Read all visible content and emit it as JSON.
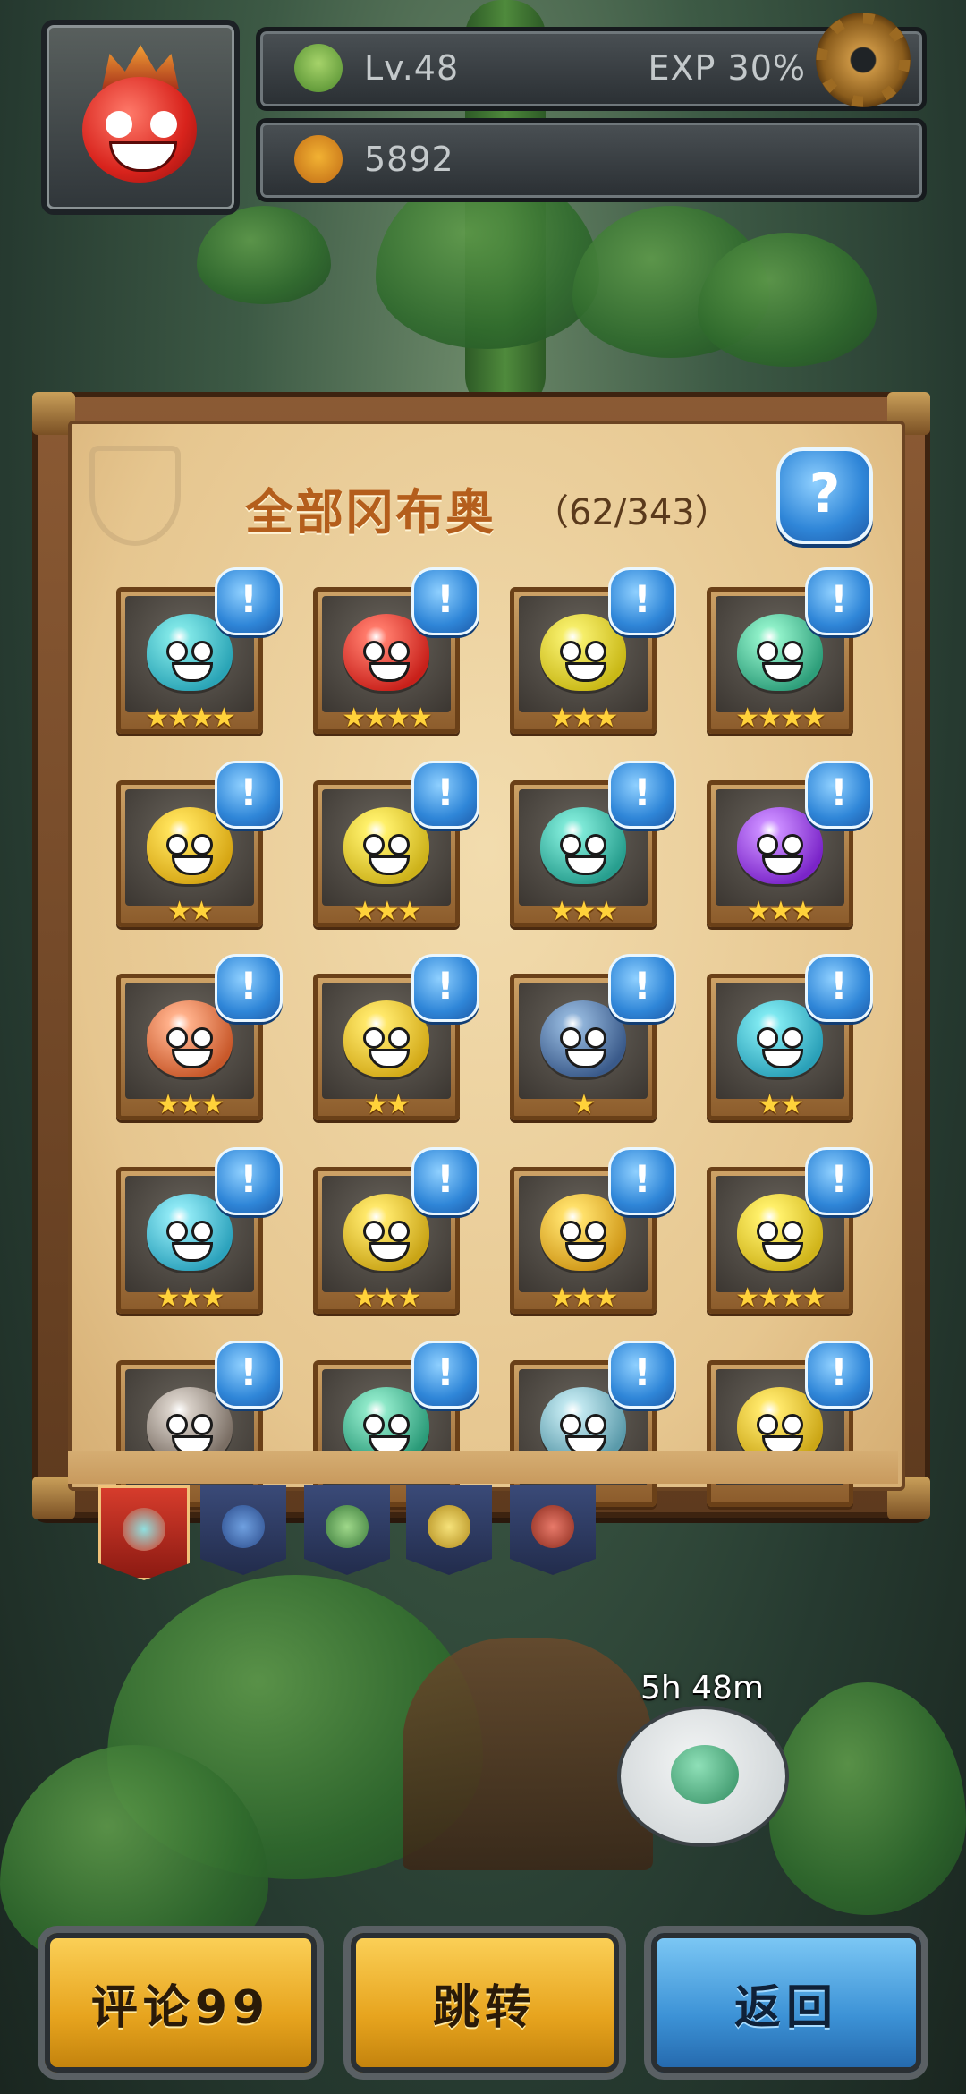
{
  "hud": {
    "level": "Lv.48",
    "exp": "EXP 30%",
    "currency": "5892"
  },
  "panel": {
    "title": "全部冈布奥",
    "count": "（62/343）",
    "help_label": "?"
  },
  "collection": [
    {
      "stars": "★★★★",
      "color1": "#7fe6e6",
      "color2": "#2aa4b6"
    },
    {
      "stars": "★★★★",
      "color1": "#ff7a6a",
      "color2": "#c8201a"
    },
    {
      "stars": "★★★",
      "color1": "#f6ee6a",
      "color2": "#c9b816"
    },
    {
      "stars": "★★★★",
      "color1": "#8ff0c8",
      "color2": "#2e9e7a"
    },
    {
      "stars": "★★",
      "color1": "#ffe25a",
      "color2": "#d6a614"
    },
    {
      "stars": "★★★",
      "color1": "#fff06a",
      "color2": "#cdb21a"
    },
    {
      "stars": "★★★",
      "color1": "#7de8d6",
      "color2": "#279e8e"
    },
    {
      "stars": "★★★",
      "color1": "#c98aff",
      "color2": "#7a24c8"
    },
    {
      "stars": "★★★",
      "color1": "#ffb08a",
      "color2": "#c8582a"
    },
    {
      "stars": "★★",
      "color1": "#ffe86a",
      "color2": "#d3aa18"
    },
    {
      "stars": "★",
      "color1": "#8fb2d8",
      "color2": "#3a5a8a"
    },
    {
      "stars": "★★",
      "color1": "#7ee8f0",
      "color2": "#2aa0b8"
    },
    {
      "stars": "★★★",
      "color1": "#8ee8f4",
      "color2": "#2ca2bc"
    },
    {
      "stars": "★★★",
      "color1": "#ffe86a",
      "color2": "#c9a416"
    },
    {
      "stars": "★★★",
      "color1": "#ffe06a",
      "color2": "#d09818"
    },
    {
      "stars": "★★★★",
      "color1": "#fff06a",
      "color2": "#d0b41a"
    },
    {
      "stars": "",
      "color1": "#d8d0c8",
      "color2": "#7a6e64"
    },
    {
      "stars": "",
      "color1": "#8ee8c8",
      "color2": "#2a9a78"
    },
    {
      "stars": "",
      "color1": "#bfe6ee",
      "color2": "#5a9aaa"
    },
    {
      "stars": "",
      "color1": "#ffe86a",
      "color2": "#cba616"
    }
  ],
  "info_label": "!",
  "tabs": [
    "all",
    "blue",
    "green",
    "yellow",
    "red"
  ],
  "timer": "5h 48m",
  "buttons": {
    "comment": "评论99",
    "jump": "跳转",
    "back": "返回"
  },
  "colors": {
    "accent_blue": "#2f86d8",
    "accent_yellow": "#e7a41e",
    "title_orange": "#b45e1c"
  }
}
